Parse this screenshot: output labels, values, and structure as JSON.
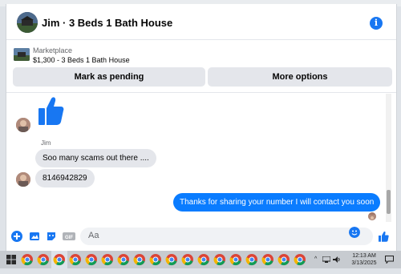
{
  "header": {
    "title": "Jim · 3 Beds 1 Bath House",
    "info_icon": "info-icon"
  },
  "listing": {
    "label": "Marketplace",
    "price_title": "$1,300 - 3 Beds 1 Bath House",
    "pending_label": "Mark as pending",
    "options_label": "More options"
  },
  "messages": {
    "sender_name": "Jim",
    "msg1": "Soo many scams out there ....",
    "msg2": "8146942829",
    "reply": "Thanks for sharing your number I will contact you soon"
  },
  "composer": {
    "placeholder": "Aa"
  },
  "taskbar": {
    "time": "12:13 AM",
    "date": "3/13/2025"
  },
  "colors": {
    "accent": "#1877f2",
    "outgoing_bubble": "#0a7cff",
    "incoming_bubble": "#e4e6eb"
  }
}
